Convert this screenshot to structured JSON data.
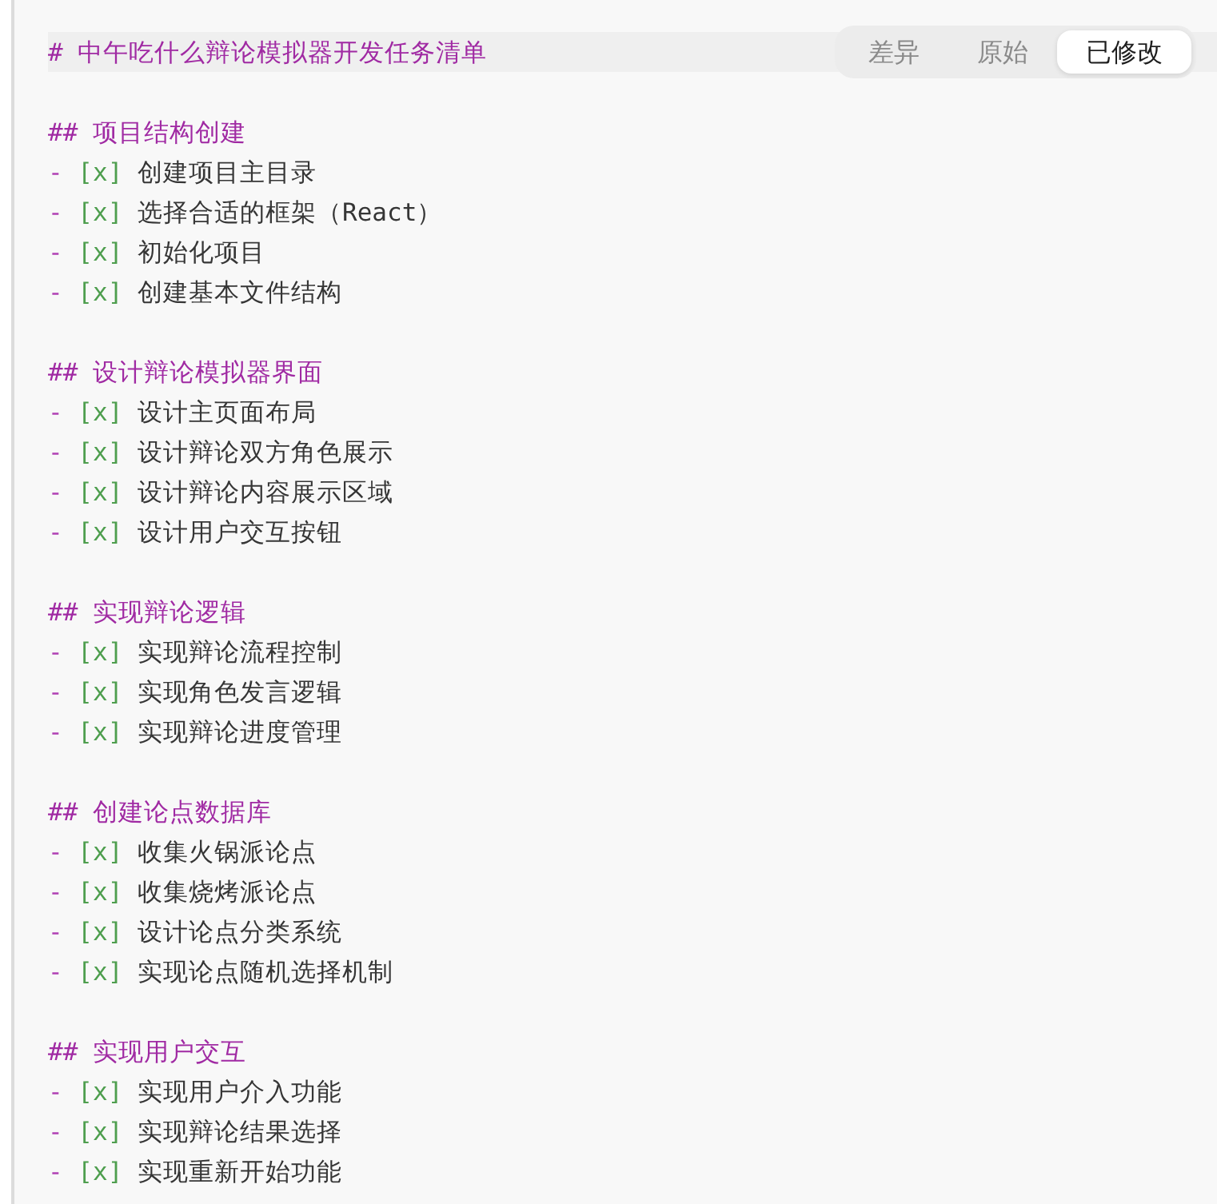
{
  "editor": {
    "title": {
      "marker": "#",
      "text": "中午吃什么辩论模拟器开发任务清单",
      "current_line": true
    },
    "view_tabs": [
      {
        "label": "差异",
        "selected": false
      },
      {
        "label": "原始",
        "selected": false
      },
      {
        "label": "已修改",
        "selected": true
      }
    ],
    "sections": [
      {
        "marker": "##",
        "heading": "项目结构创建",
        "tasks": [
          {
            "bullet": "-",
            "box": "[x]",
            "text": "创建项目主目录"
          },
          {
            "bullet": "-",
            "box": "[x]",
            "text": "选择合适的框架（React）"
          },
          {
            "bullet": "-",
            "box": "[x]",
            "text": "初始化项目"
          },
          {
            "bullet": "-",
            "box": "[x]",
            "text": "创建基本文件结构"
          }
        ]
      },
      {
        "marker": "##",
        "heading": "设计辩论模拟器界面",
        "tasks": [
          {
            "bullet": "-",
            "box": "[x]",
            "text": "设计主页面布局"
          },
          {
            "bullet": "-",
            "box": "[x]",
            "text": "设计辩论双方角色展示"
          },
          {
            "bullet": "-",
            "box": "[x]",
            "text": "设计辩论内容展示区域"
          },
          {
            "bullet": "-",
            "box": "[x]",
            "text": "设计用户交互按钮"
          }
        ]
      },
      {
        "marker": "##",
        "heading": "实现辩论逻辑",
        "tasks": [
          {
            "bullet": "-",
            "box": "[x]",
            "text": "实现辩论流程控制"
          },
          {
            "bullet": "-",
            "box": "[x]",
            "text": "实现角色发言逻辑"
          },
          {
            "bullet": "-",
            "box": "[x]",
            "text": "实现辩论进度管理"
          }
        ]
      },
      {
        "marker": "##",
        "heading": "创建论点数据库",
        "tasks": [
          {
            "bullet": "-",
            "box": "[x]",
            "text": "收集火锅派论点"
          },
          {
            "bullet": "-",
            "box": "[x]",
            "text": "收集烧烤派论点"
          },
          {
            "bullet": "-",
            "box": "[x]",
            "text": "设计论点分类系统"
          },
          {
            "bullet": "-",
            "box": "[x]",
            "text": "实现论点随机选择机制"
          }
        ]
      },
      {
        "marker": "##",
        "heading": "实现用户交互",
        "tasks": [
          {
            "bullet": "-",
            "box": "[x]",
            "text": "实现用户介入功能"
          },
          {
            "bullet": "-",
            "box": "[x]",
            "text": "实现辩论结果选择"
          },
          {
            "bullet": "-",
            "box": "[x]",
            "text": "实现重新开始功能"
          }
        ]
      }
    ]
  }
}
